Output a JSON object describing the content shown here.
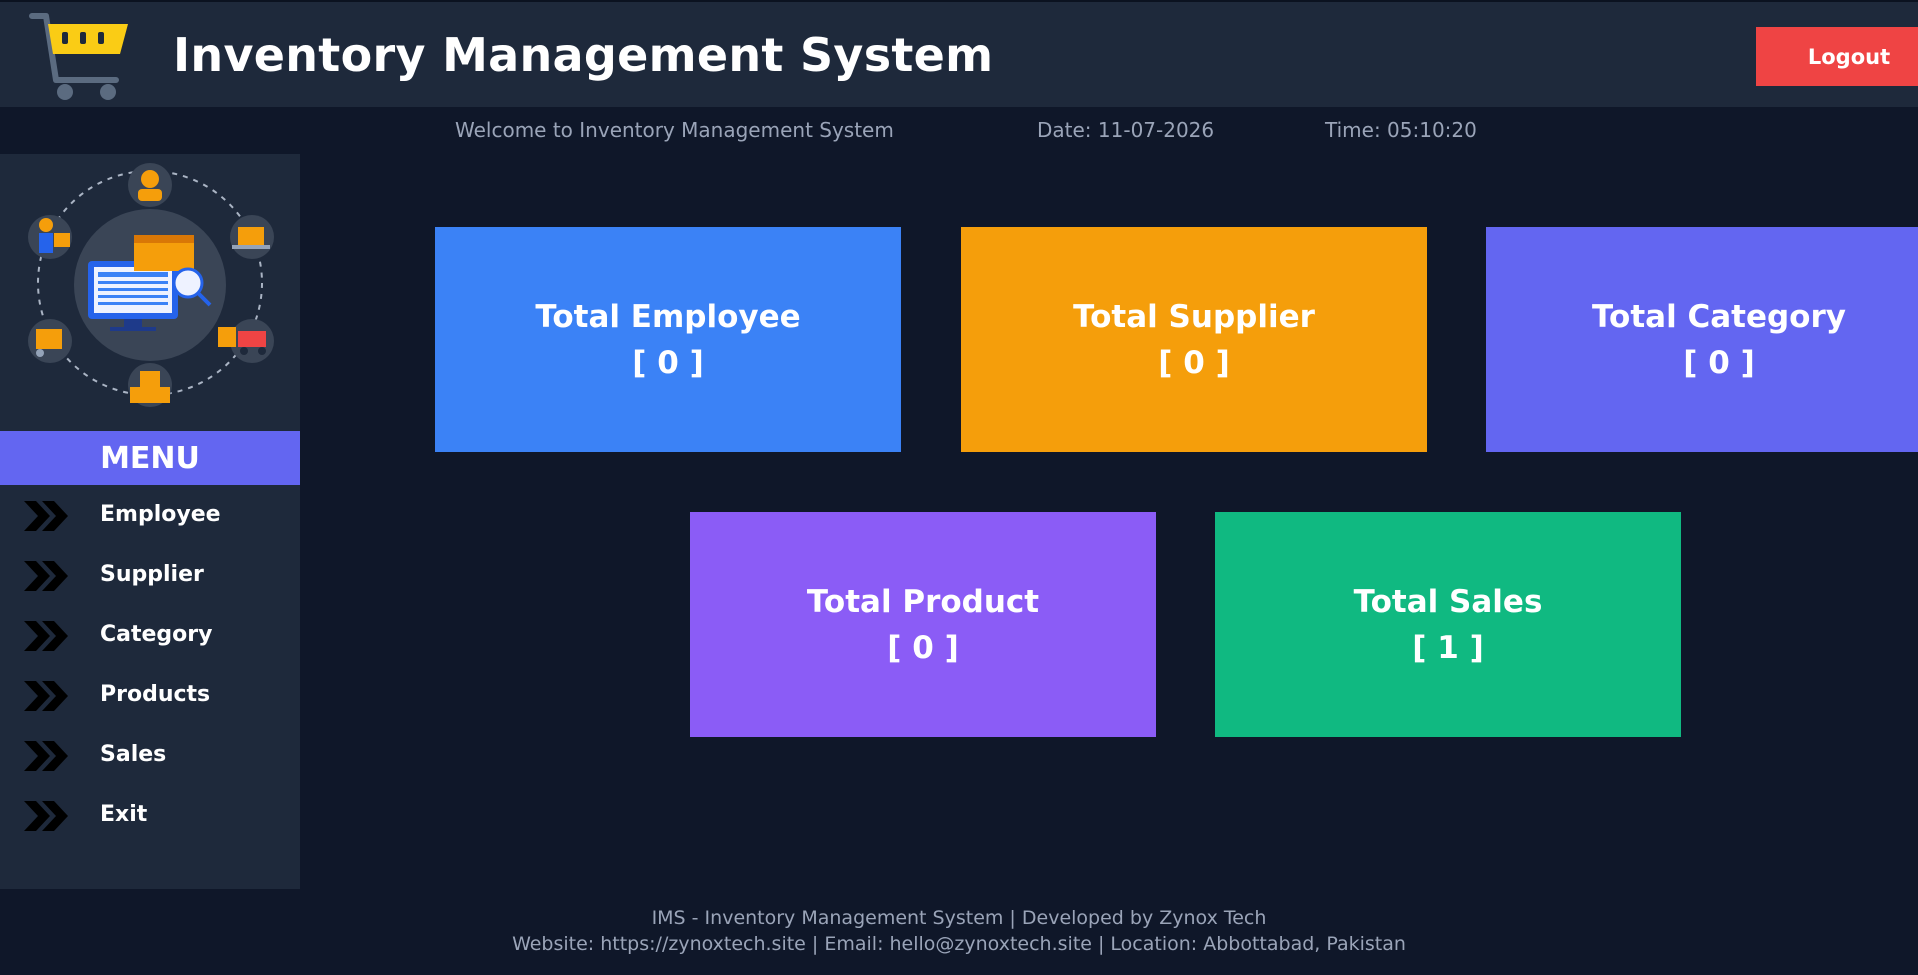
{
  "header": {
    "title": "Inventory Management System",
    "logout_label": "Logout"
  },
  "subheader": {
    "welcome": "Welcome to Inventory Management System",
    "date": "Date: 11-07-2026",
    "time": "Time: 05:10:20"
  },
  "sidebar": {
    "menu_title": "MENU",
    "items": [
      {
        "label": "Employee"
      },
      {
        "label": "Supplier"
      },
      {
        "label": "Category"
      },
      {
        "label": "Products"
      },
      {
        "label": "Sales"
      },
      {
        "label": "Exit"
      }
    ]
  },
  "cards": {
    "employee": {
      "title": "Total Employee",
      "value": "[ 0 ]"
    },
    "supplier": {
      "title": "Total Supplier",
      "value": "[ 0 ]"
    },
    "category": {
      "title": "Total Category",
      "value": "[ 0 ]"
    },
    "product": {
      "title": "Total Product",
      "value": "[ 0 ]"
    },
    "sales": {
      "title": "Total Sales",
      "value": "[ 1 ]"
    }
  },
  "footer": {
    "line1": "IMS - Inventory Management System | Developed by Zynox Tech",
    "line2": "Website: https://zynoxtech.site | Email: hello@zynoxtech.site | Location: Abbottabad, Pakistan"
  },
  "colors": {
    "background": "#0f1729",
    "panel": "#1e293b",
    "logout": "#ef4444",
    "menu": "#6366f1",
    "employee": "#3b82f6",
    "supplier": "#f59e0b",
    "category": "#6366f1",
    "product": "#8b5cf6",
    "sales": "#10b981"
  },
  "icons": {
    "logo": "shopping-cart-icon",
    "menu_item": "double-chevron-right-icon",
    "sidebar_art": "inventory-illustration"
  }
}
